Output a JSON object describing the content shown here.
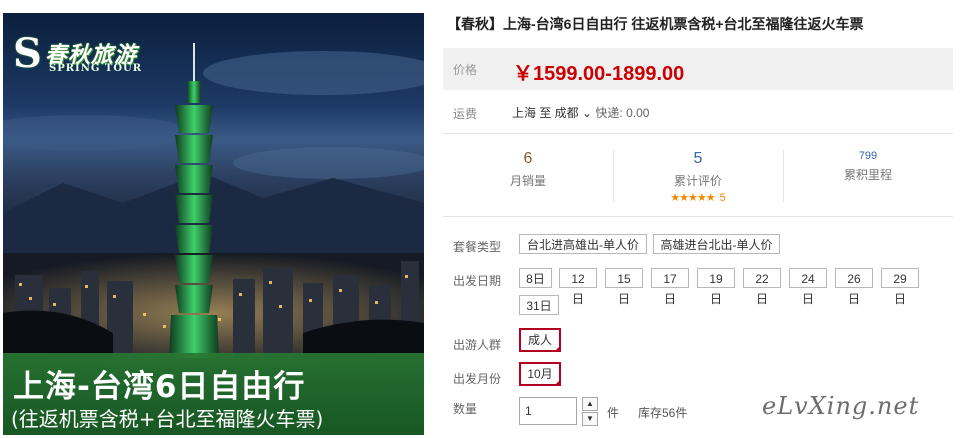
{
  "promo": {
    "logo_cn": "春秋旅游",
    "logo_en": "SPRING TOUR",
    "banner_title": "上海-台湾6日自由行",
    "banner_subtitle": "(往返机票含税+台北至福隆火车票)"
  },
  "product": {
    "title": "【春秋】上海-台湾6日自由行 往返机票含税+台北至福隆往返火车票",
    "price_label": "价格",
    "price": "￥1599.00-1899.00"
  },
  "shipping": {
    "label": "运费",
    "route": "上海 至 成都",
    "fee": "快递: 0.00"
  },
  "stats": [
    {
      "value": "6",
      "label": "月销量"
    },
    {
      "value": "5",
      "label": "累计评价",
      "stars": "★★★★★",
      "rating": "5"
    },
    {
      "value": "799",
      "label": "累积里程"
    }
  ],
  "package": {
    "label": "套餐类型",
    "options": [
      "台北进高雄出-单人价",
      "高雄进台北出-单人价"
    ]
  },
  "dates": {
    "label": "出发日期",
    "options": [
      "8日",
      "12日",
      "15日",
      "17日",
      "19日",
      "22日",
      "24日",
      "26日",
      "29日",
      "31日"
    ]
  },
  "crowd": {
    "label": "出游人群",
    "selected": "成人"
  },
  "month": {
    "label": "出发月份",
    "selected": "10月"
  },
  "quantity": {
    "label": "数量",
    "value": "1",
    "unit": "件",
    "stock": "库存56件"
  },
  "watermark": "eLvXing.net",
  "colors": {
    "price": "#cc0000",
    "selected_border": "#b4001f",
    "banner_green": "#247a33",
    "stars": "#f08a00"
  }
}
